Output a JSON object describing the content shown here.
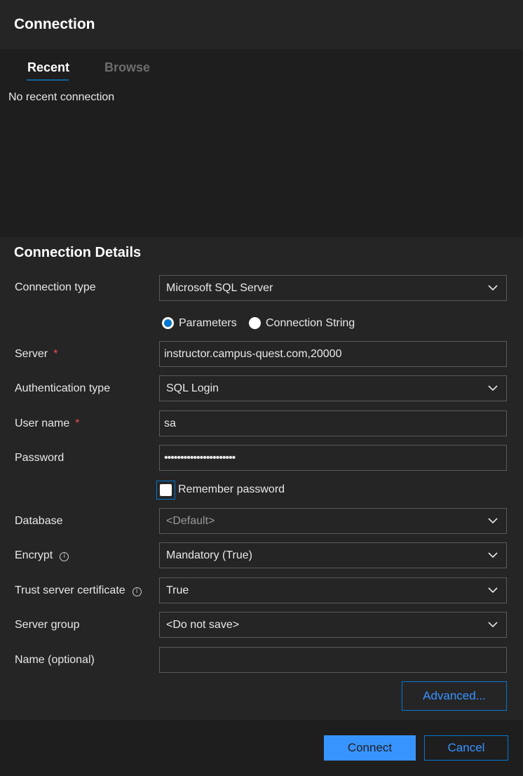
{
  "header": {
    "title": "Connection"
  },
  "tabs": [
    {
      "label": "Recent",
      "active": true
    },
    {
      "label": "Browse",
      "active": false
    }
  ],
  "recent": {
    "empty_text": "No recent connection"
  },
  "details": {
    "title": "Connection Details",
    "connection_type": {
      "label": "Connection type",
      "value": "Microsoft SQL Server"
    },
    "input_mode": {
      "options": [
        "Parameters",
        "Connection String"
      ],
      "selected": "Parameters"
    },
    "server": {
      "label": "Server",
      "required_mark": "*",
      "value": "instructor.campus-quest.com,20000"
    },
    "auth_type": {
      "label": "Authentication type",
      "value": "SQL Login"
    },
    "user_name": {
      "label": "User name",
      "required_mark": "*",
      "value": "sa"
    },
    "password": {
      "label": "Password",
      "value": "••••••••••••••••••••••"
    },
    "remember_password": {
      "label": "Remember password",
      "checked": false
    },
    "database": {
      "label": "Database",
      "placeholder": "<Default>"
    },
    "encrypt": {
      "label": "Encrypt",
      "value": "Mandatory (True)",
      "info_icon": "info-icon"
    },
    "trust_cert": {
      "label": "Trust server certificate",
      "value": "True",
      "info_icon": "info-icon"
    },
    "server_group": {
      "label": "Server group",
      "value": "<Do not save>"
    },
    "name": {
      "label": "Name (optional)",
      "value": ""
    },
    "advanced_label": "Advanced..."
  },
  "footer": {
    "connect_label": "Connect",
    "cancel_label": "Cancel"
  },
  "colors": {
    "accent": "#3794ff",
    "focus_border": "#0078d4",
    "required": "#f14c4c",
    "background": "#252526",
    "panel": "#1e1e1e"
  }
}
